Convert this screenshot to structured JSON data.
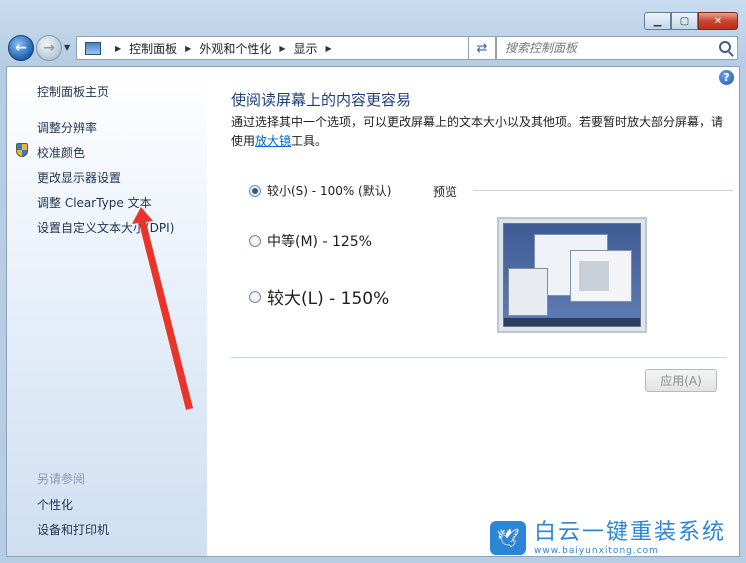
{
  "address": {
    "crumbs": [
      "控制面板",
      "外观和个性化",
      "显示"
    ]
  },
  "search": {
    "placeholder": "搜索控制面板"
  },
  "sidebar": {
    "home": "控制面板主页",
    "items": [
      "调整分辨率",
      "校准颜色",
      "更改显示器设置",
      "调整 ClearType 文本",
      "设置自定义文本大小(DPI)"
    ],
    "see_also_label": "另请参阅",
    "see_also": [
      "个性化",
      "设备和打印机"
    ]
  },
  "main": {
    "title": "使阅读屏幕上的内容更容易",
    "desc_part1": "通过选择其中一个选项，可以更改屏幕上的文本大小以及其他项。若要暂时放大部分屏幕，请使用",
    "desc_link": "放大镜",
    "desc_part2": "工具。",
    "options": [
      {
        "label": "较小(S) - 100% (默认)",
        "checked": true
      },
      {
        "label": "中等(M) - 125%",
        "checked": false
      },
      {
        "label": "较大(L) - 150%",
        "checked": false
      }
    ],
    "preview_label": "预览",
    "apply_label": "应用(A)"
  },
  "watermark": {
    "brand": "白云一键重装系统",
    "url": "www.baiyunxitong.com"
  },
  "colors": {
    "annotation_arrow": "#e8352b",
    "link": "#0066cc",
    "title": "#1e3f7a"
  }
}
